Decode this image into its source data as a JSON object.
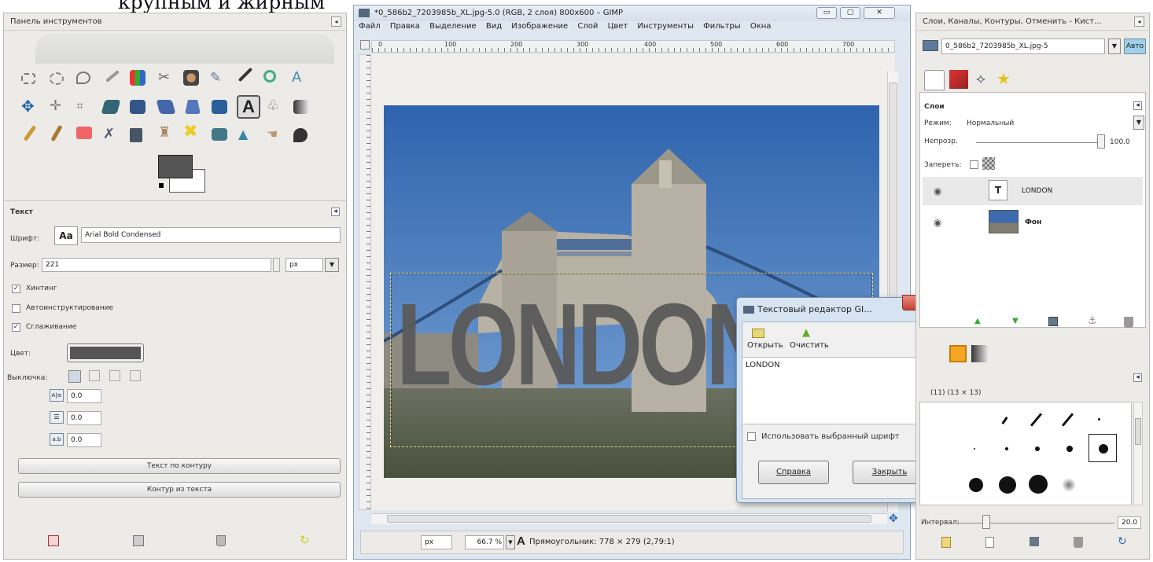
{
  "top_caption": "крупным и жирным",
  "toolbox": {
    "title": "Панель инструментов",
    "options_title": "Текст",
    "font_label": "Шрифт:",
    "font_preview": "Aa",
    "font_value": "Arial Bold Condensed",
    "size_label": "Размер:",
    "size_value": "221",
    "size_unit": "px",
    "hinting_label": "Хинтинг",
    "autohint_label": "Автоинструктирование",
    "antialias_label": "Сглаживание",
    "color_label": "Цвет:",
    "justify_label": "Выключка:",
    "indent_value": "0.0",
    "line_spacing_value": "0.0",
    "letter_spacing_value": "0.0",
    "text_along_path": "Текст по контуру",
    "path_from_text": "Контур из текста"
  },
  "image_window": {
    "title": "*0_586b2_7203985b_XL.jpg-5.0 (RGB, 2 слоя) 800x600 – GIMP",
    "menus": [
      "Файл",
      "Правка",
      "Выделение",
      "Вид",
      "Изображение",
      "Слой",
      "Цвет",
      "Инструменты",
      "Фильтры",
      "Окна"
    ],
    "ruler_labels": [
      "0",
      "100",
      "200",
      "300",
      "400",
      "500",
      "600",
      "700"
    ],
    "canvas_text": "LONDON",
    "unit": "px",
    "zoom": "66.7 %",
    "status": "Прямоугольник: 778 × 279 (2,79:1)"
  },
  "text_editor": {
    "title": "Текстовый редактор GI...",
    "open_label": "Открыть",
    "clear_label": "Очистить",
    "text": "LONDON",
    "use_font_label": "Использовать выбранный шрифт",
    "help_label": "Справка",
    "close_label": "Закрыть"
  },
  "layers_dock": {
    "title": "Слои, Каналы, Контуры, Отменить - Кист...",
    "image_name": "0_586b2_7203985b_XL.jpg-5",
    "auto_label": "Авто",
    "section_title": "Слои",
    "mode_label": "Режим:",
    "mode_value": "Нормальный",
    "opacity_label": "Непрозр.",
    "opacity_value": "100.0",
    "lock_label": "Запереть:",
    "layers": [
      {
        "name": "LONDON",
        "type": "text"
      },
      {
        "name": "Фон",
        "type": "image"
      }
    ],
    "brush_info": "(11) (13 × 13)",
    "spacing_label": "Интервал:",
    "spacing_value": "20.0"
  },
  "colors": {
    "fg_color": "#555555",
    "text_color": "#5a5a5a",
    "sky": "#3f73b8",
    "water": "#58614a",
    "close_red": "#c8423a"
  }
}
